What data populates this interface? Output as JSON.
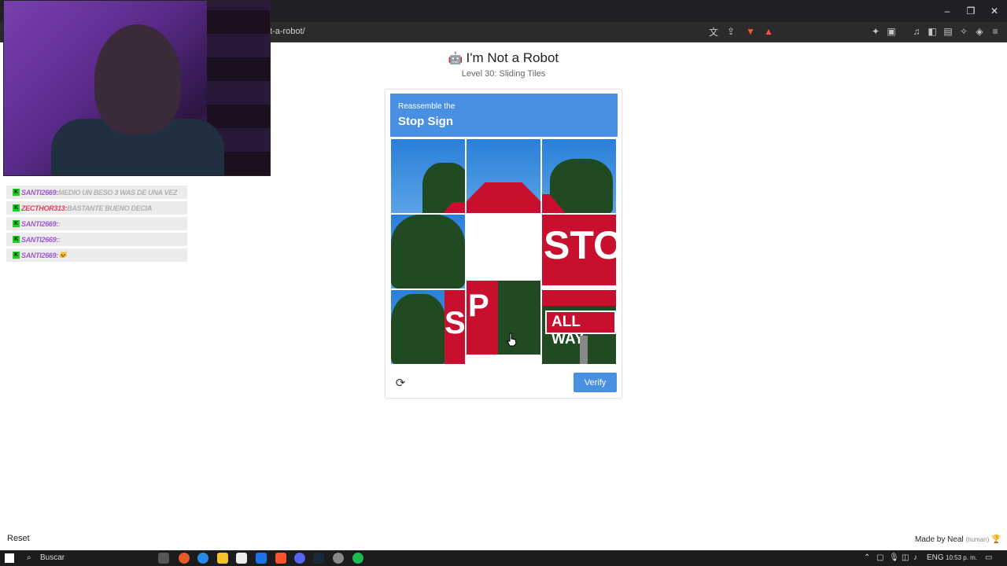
{
  "browser": {
    "url_fragment": "t-a-robot/",
    "window_controls": [
      "–",
      "❐",
      "✕"
    ]
  },
  "stream_chat": [
    {
      "user": "SANTI2669:",
      "message": "MEDIO UN BESO 3 WAS DE UNA VEZ",
      "user_color": "purple"
    },
    {
      "user": "ZECTHOR313:",
      "message": "BASTANTE BUENO DECIA",
      "user_color": "red"
    },
    {
      "user": "SANTI2669:",
      "message": ":",
      "user_color": "purple"
    },
    {
      "user": "SANTI2669:",
      "message": ":",
      "user_color": "purple"
    },
    {
      "user": "SANTI2669:",
      "message": "🐱",
      "user_color": "purple"
    }
  ],
  "page": {
    "robot_icon": "🤖",
    "title": "I'm Not a Robot",
    "subtitle": "Level 30: Sliding Tiles"
  },
  "captcha": {
    "instruction": "Reassemble the",
    "target": "Stop Sign",
    "verify_label": "Verify",
    "refresh_icon": "⟳",
    "accent_color": "#4a90e2"
  },
  "footer": {
    "reset_label": "Reset",
    "made_by": "Made by Neal",
    "human_tag": "(human)"
  },
  "taskbar": {
    "search_label": "Buscar",
    "lang": "ENG",
    "time": "10:53 p. m."
  }
}
